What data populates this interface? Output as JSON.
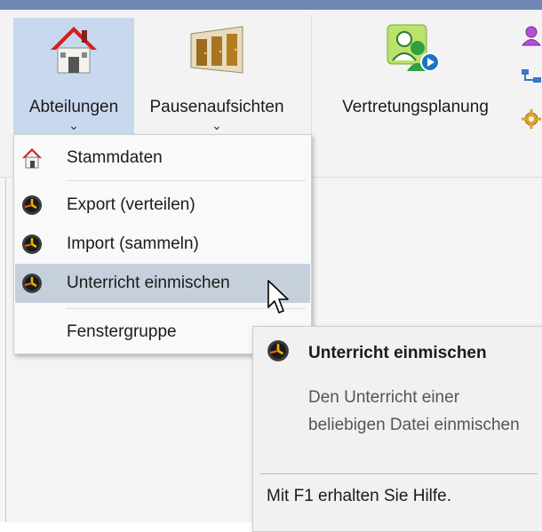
{
  "ribbon": {
    "buttons": [
      {
        "label": "Abteilungen",
        "chevron": "⌄",
        "icon": "house-icon"
      },
      {
        "label": "Pausenaufsichten",
        "chevron": "⌄",
        "icon": "doors-icon"
      },
      {
        "label": "Vertretungsplanung",
        "icon": "substitution-person-icon"
      }
    ],
    "small_icons": [
      "person-icon",
      "network-icon",
      "gear-icon"
    ]
  },
  "menu": {
    "items": [
      {
        "label": "Stammdaten",
        "icon": "house-icon"
      },
      {
        "label": "Export (verteilen)",
        "icon": "clock-icon"
      },
      {
        "label": "Import (sammeln)",
        "icon": "clock-icon"
      },
      {
        "label": "Unterricht einmischen",
        "icon": "clock-icon",
        "highlighted": true
      },
      {
        "label": "Fenstergruppe",
        "has_submenu": true
      }
    ]
  },
  "tooltip": {
    "title": "Unterricht einmischen",
    "description": "Den Unterricht einer beliebigen Datei einmischen",
    "help": "Mit F1 erhalten Sie Hilfe."
  },
  "colors": {
    "topbar": "#6f88b3",
    "ribbon_bg": "#f3f3f3",
    "active_button": "#c8d9ef",
    "menu_highlight": "#c6d0dc"
  }
}
